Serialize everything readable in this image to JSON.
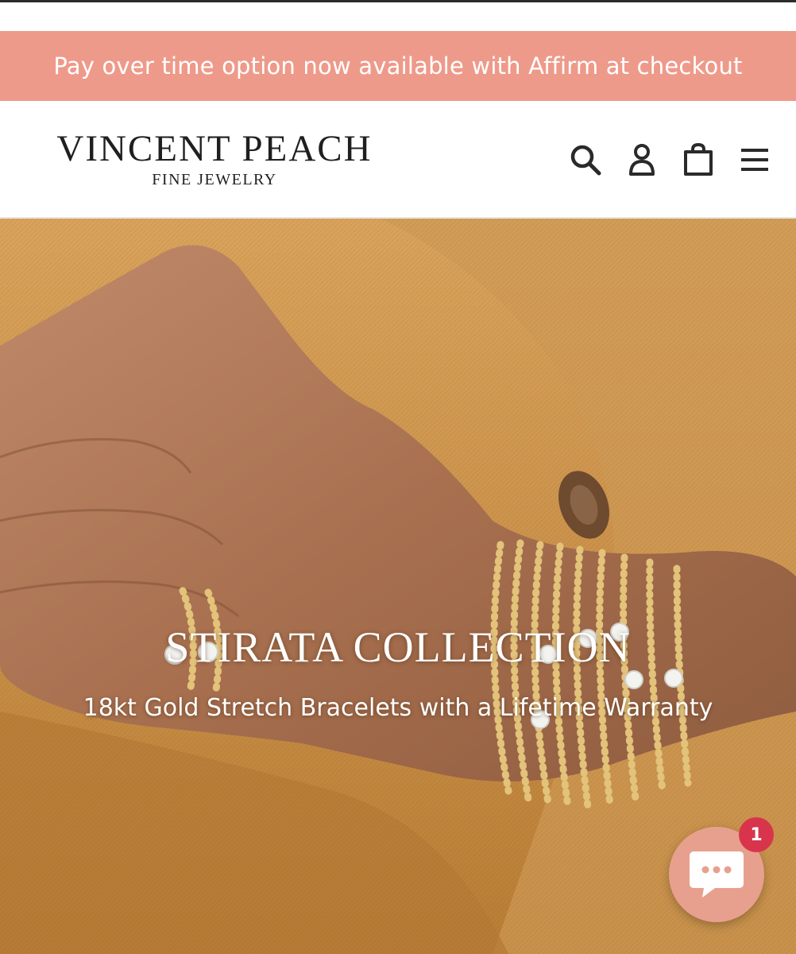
{
  "announcement": {
    "text": "Pay over time option now available with Affirm at checkout"
  },
  "header": {
    "logo_main": "VINCENT PEACH",
    "logo_sub": "FINE JEWELRY",
    "icons": [
      "search-icon",
      "account-icon",
      "cart-icon",
      "menu-icon"
    ]
  },
  "hero": {
    "title": "STIRATA COLLECTION",
    "subtitle": "18kt Gold Stretch Bracelets with a Lifetime Warranty"
  },
  "chat": {
    "badge_count": "1",
    "icon": "chat-bubble-icon"
  },
  "colors": {
    "announcement_bg": "#ee9a8a",
    "chat_bg": "#e8a08e",
    "badge_bg": "#d8354c",
    "text_dark": "#1f1f1f"
  }
}
